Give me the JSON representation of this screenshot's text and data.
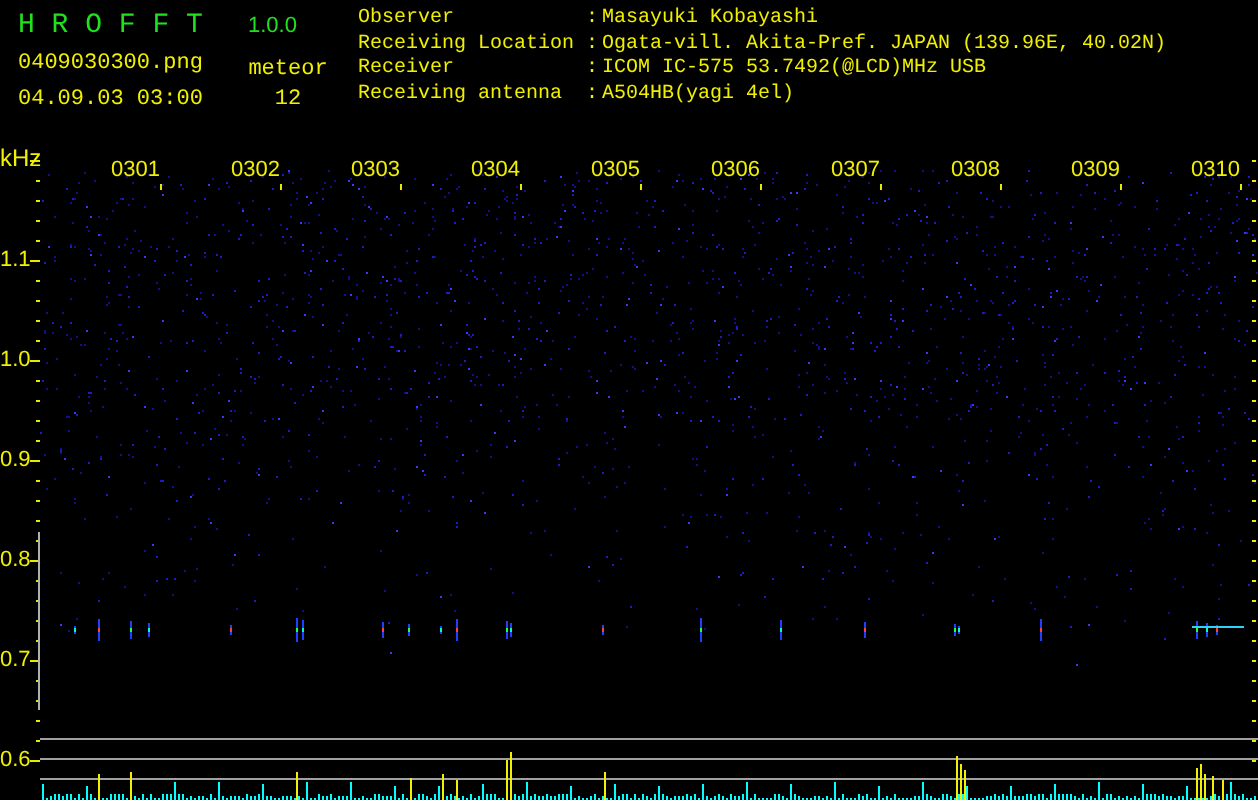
{
  "app": {
    "name": "H R O F F T",
    "version": "1.0.0"
  },
  "file": "0409030300.png",
  "datetime": "04.09.03 03:00",
  "meteor": {
    "label": "meteor",
    "count": "12"
  },
  "info": [
    {
      "label": "Observer",
      "separator": ":",
      "value": "Masayuki Kobayashi"
    },
    {
      "label": "Receiving Location",
      "separator": ":",
      "value": "Ogata-vill. Akita-Pref. JAPAN (139.96E, 40.02N)"
    },
    {
      "label": "Receiver",
      "separator": ":",
      "value": "ICOM IC-575 53.7492(@LCD)MHz USB"
    },
    {
      "label": "Receiving antenna",
      "separator": ":",
      "value": "A504HB(yagi 4el)"
    }
  ],
  "spectrogram": {
    "unit": "kHz",
    "y_labels": [
      "1.1",
      "1.0",
      "0.9",
      "0.8",
      "0.7",
      "0.6"
    ],
    "time_labels": [
      "0301",
      "0302",
      "0303",
      "0304",
      "0305",
      "0306",
      "0307",
      "0308",
      "0309",
      "0310"
    ]
  }
}
